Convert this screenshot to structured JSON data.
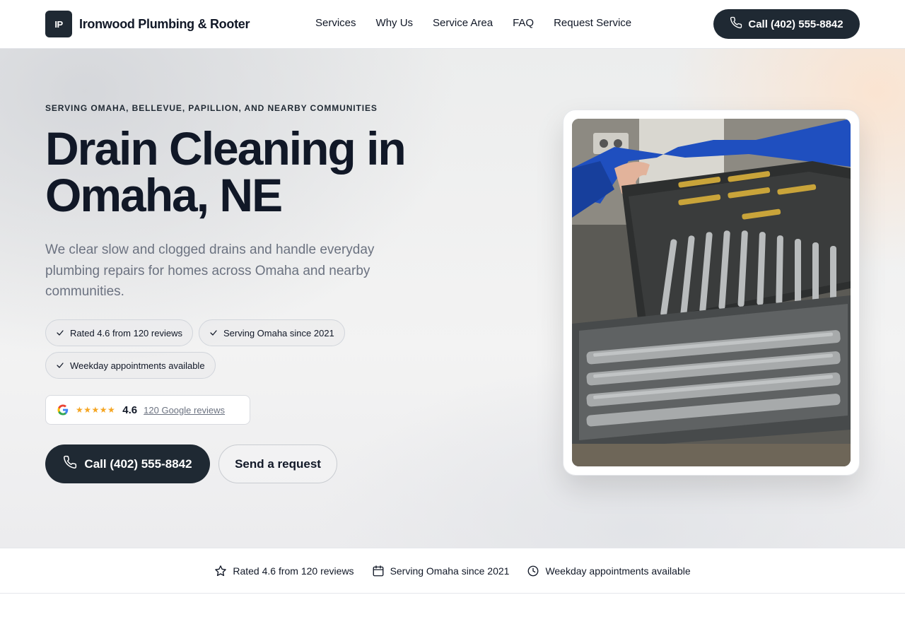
{
  "header": {
    "logo_initials": "IP",
    "brand_name": "Ironwood Plumbing & Rooter",
    "nav": [
      "Services",
      "Why Us",
      "Service Area",
      "FAQ",
      "Request Service"
    ],
    "call_label": "Call (402) 555-8842"
  },
  "hero": {
    "eyebrow": "SERVING OMAHA, BELLEVUE, PAPILLION, AND NEARBY COMMUNITIES",
    "headline": "Drain Cleaning in Omaha, NE",
    "lede": "We clear slow and clogged drains and handle everyday plumbing repairs for homes across Omaha and nearby communities.",
    "badges": [
      "Rated 4.6 from 120 reviews",
      "Serving Omaha since 2021",
      "Weekday appointments available"
    ],
    "rating": {
      "stars": "★★★★★",
      "value": "4.6",
      "reviews_link": "120 Google reviews"
    },
    "call_button": "Call (402) 555-8842",
    "request_button": "Send a request"
  },
  "trust_strip": [
    {
      "icon": "star-icon",
      "label": "Rated 4.6 from 120 reviews"
    },
    {
      "icon": "calendar-icon",
      "label": "Serving Omaha since 2021"
    },
    {
      "icon": "clock-icon",
      "label": "Weekday appointments available"
    }
  ],
  "colors": {
    "primary": "#1f2933",
    "star": "#f5a623",
    "muted_text": "#6b7280"
  }
}
